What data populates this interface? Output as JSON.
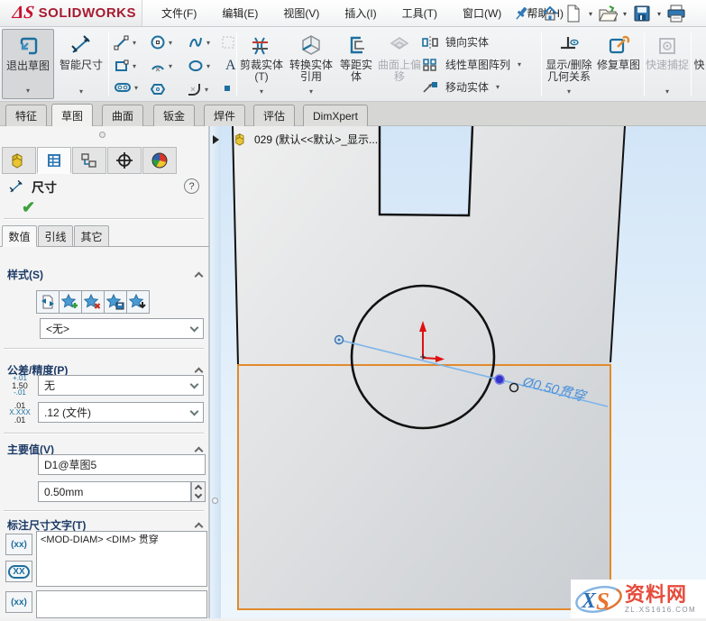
{
  "brand": {
    "mark": "ΔS",
    "name": "SOLIDWORKS"
  },
  "menu": {
    "items": [
      "文件(F)",
      "编辑(E)",
      "视图(V)",
      "插入(I)",
      "工具(T)",
      "窗口(W)",
      "帮助(H)"
    ]
  },
  "toolbar": {
    "exit_sketch": "退出草图",
    "smart_dimension": "智能尺寸",
    "trim_entities": "剪裁实体(T)",
    "convert_entities": "转换实体引用",
    "offset_entities": "等距实体",
    "offset_on_surface": "曲面上偏移",
    "mirror_entities": "镜向实体",
    "linear_pattern": "线性草图阵列",
    "move_entities": "移动实体",
    "display_delete_relations": "显示/删除几何关系",
    "repair_sketch": "修复草图",
    "quick_snaps": "快速捕捉",
    "partial_button": "快"
  },
  "ribbon_tabs": [
    "特征",
    "草图",
    "曲面",
    "钣金",
    "焊件",
    "评估",
    "DimXpert"
  ],
  "panel": {
    "title": "尺寸",
    "help": "?",
    "check": "✔",
    "value_tabs": [
      "数值",
      "引线",
      "其它"
    ],
    "style": {
      "label": "样式(S)",
      "selected": "<无>"
    },
    "tolerance": {
      "label": "公差/精度(P)",
      "type_value": "无",
      "precision_value": ".12 (文件)",
      "tol_icon": {
        "top": "+.01",
        "mid": "1.50",
        "bot": "-.01"
      },
      "prec_icon": {
        "top": ".01",
        "mid": "X.XXX",
        "bot": ".01"
      }
    },
    "primary_value": {
      "label": "主要值(V)",
      "name": "D1@草图5",
      "value": "0.50mm"
    },
    "dim_text": {
      "label": "标注尺寸文字(T)",
      "value": "<MOD-DIAM> <DIM> 贯穿",
      "btn1": "(xx)",
      "btn2": "XX",
      "btn3": "(xx)"
    }
  },
  "graphics": {
    "tree_label": "029  (默认<<默认>_显示...",
    "dimension_label": "Ø0.50贯穿",
    "watermark": {
      "x": "X",
      "s": "S",
      "text": "资料网",
      "sub": "ZL.XS1616.COM"
    }
  },
  "colors": {
    "accent_orange": "#e18a2c",
    "dimension_blue": "#4a90d9",
    "icon_teal": "#1c6f9f",
    "logo_red": "#c8102e",
    "origin_red": "#e01010"
  }
}
